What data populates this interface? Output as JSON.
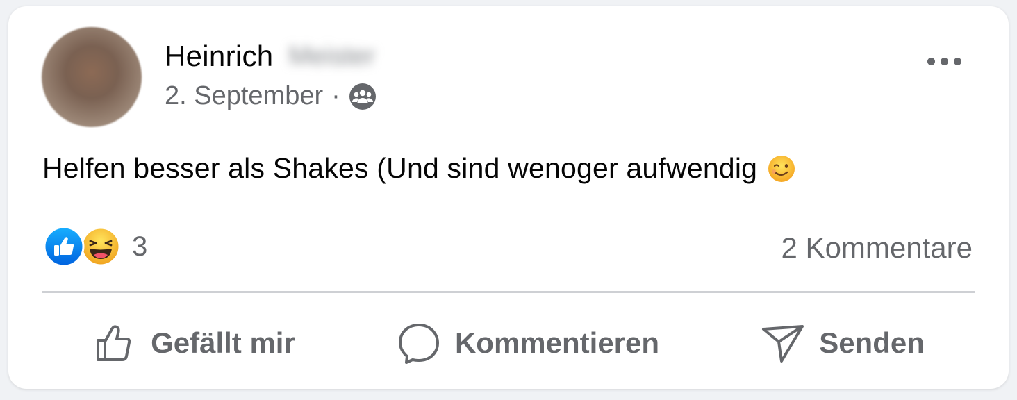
{
  "post": {
    "author_first_name": "Heinrich",
    "author_last_name_blurred": "Meister",
    "date": "2. September",
    "meta_separator": "·",
    "audience_icon": "friends-icon",
    "text": "Helfen besser als Shakes (Und sind wenoger aufwendig",
    "text_emoji": "wink-emoji"
  },
  "reactions": {
    "icons": [
      "like-reaction-icon",
      "haha-reaction-icon"
    ],
    "count": "3",
    "comments_label": "2 Kommentare"
  },
  "actions": {
    "like_label": "Gefällt mir",
    "comment_label": "Kommentieren",
    "send_label": "Senden"
  },
  "colors": {
    "background": "#f0f2f5",
    "card": "#ffffff",
    "text_primary": "#050505",
    "text_secondary": "#65676b",
    "like_blue": "#1877f2",
    "haha_yellow": "#f7b928",
    "divider": "#ced0d4"
  }
}
